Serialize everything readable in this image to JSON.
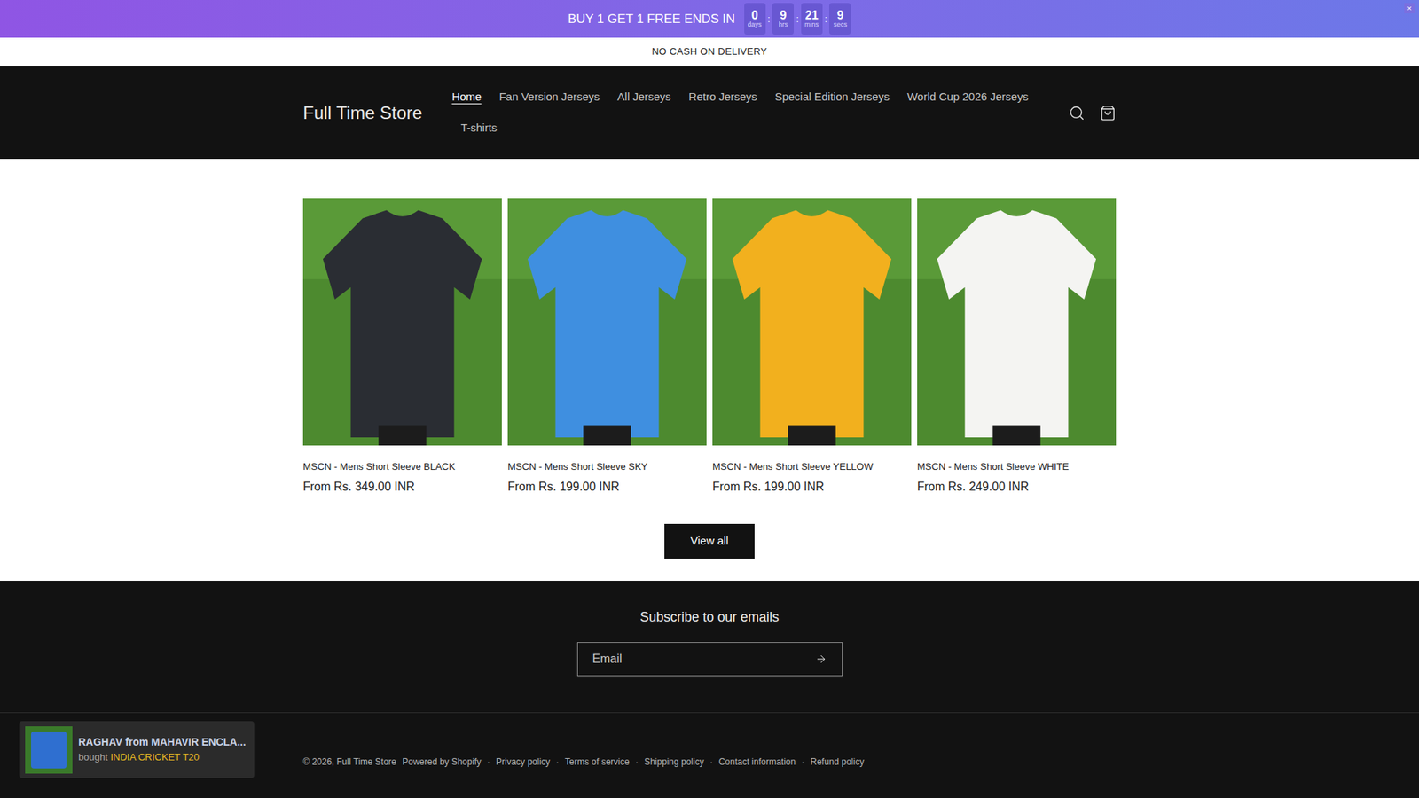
{
  "banner": {
    "text": "BUY 1 GET 1 FREE ENDS IN",
    "separator": ":",
    "close": "×",
    "countdown": [
      {
        "value": "0",
        "unit": "days"
      },
      {
        "value": "9",
        "unit": "hrs"
      },
      {
        "value": "21",
        "unit": "mins"
      },
      {
        "value": "9",
        "unit": "secs"
      }
    ]
  },
  "notice": "NO CASH ON DELIVERY",
  "header": {
    "logo": "Full Time Store",
    "nav": [
      {
        "label": "Home",
        "selected": true
      },
      {
        "label": "Fan Version Jerseys",
        "selected": false
      },
      {
        "label": "All Jerseys",
        "selected": false
      },
      {
        "label": "Retro Jerseys",
        "selected": false
      },
      {
        "label": "Special Edition Jerseys",
        "selected": false
      },
      {
        "label": "World Cup 2026 Jerseys",
        "selected": false
      },
      {
        "label": "T-shirts",
        "selected": false
      }
    ]
  },
  "products": [
    {
      "title": "MSCN - Mens Short Sleeve BLACK",
      "price": "From Rs. 349.00 INR",
      "color": "#2a2d33"
    },
    {
      "title": "MSCN - Mens Short Sleeve SKY",
      "price": "From Rs. 199.00 INR",
      "color": "#3f8fe0"
    },
    {
      "title": "MSCN - Mens Short Sleeve YELLOW",
      "price": "From Rs. 199.00 INR",
      "color": "#f2b01e"
    },
    {
      "title": "MSCN - Mens Short Sleeve WHITE",
      "price": "From Rs. 249.00 INR",
      "color": "#f4f4f2"
    }
  ],
  "view_all": "View all",
  "footer": {
    "subscribe_title": "Subscribe to our emails",
    "email_placeholder": "Email",
    "copyright": "© 2026, Full Time Store",
    "powered": "Powered by Shopify",
    "separator": "·",
    "links": [
      "Privacy policy",
      "Terms of service",
      "Shipping policy",
      "Contact information",
      "Refund policy"
    ]
  },
  "toast": {
    "name": "RAGHAV from MAHAVIR ENCLA...",
    "verb": "bought",
    "product": "INDIA CRICKET T20"
  }
}
